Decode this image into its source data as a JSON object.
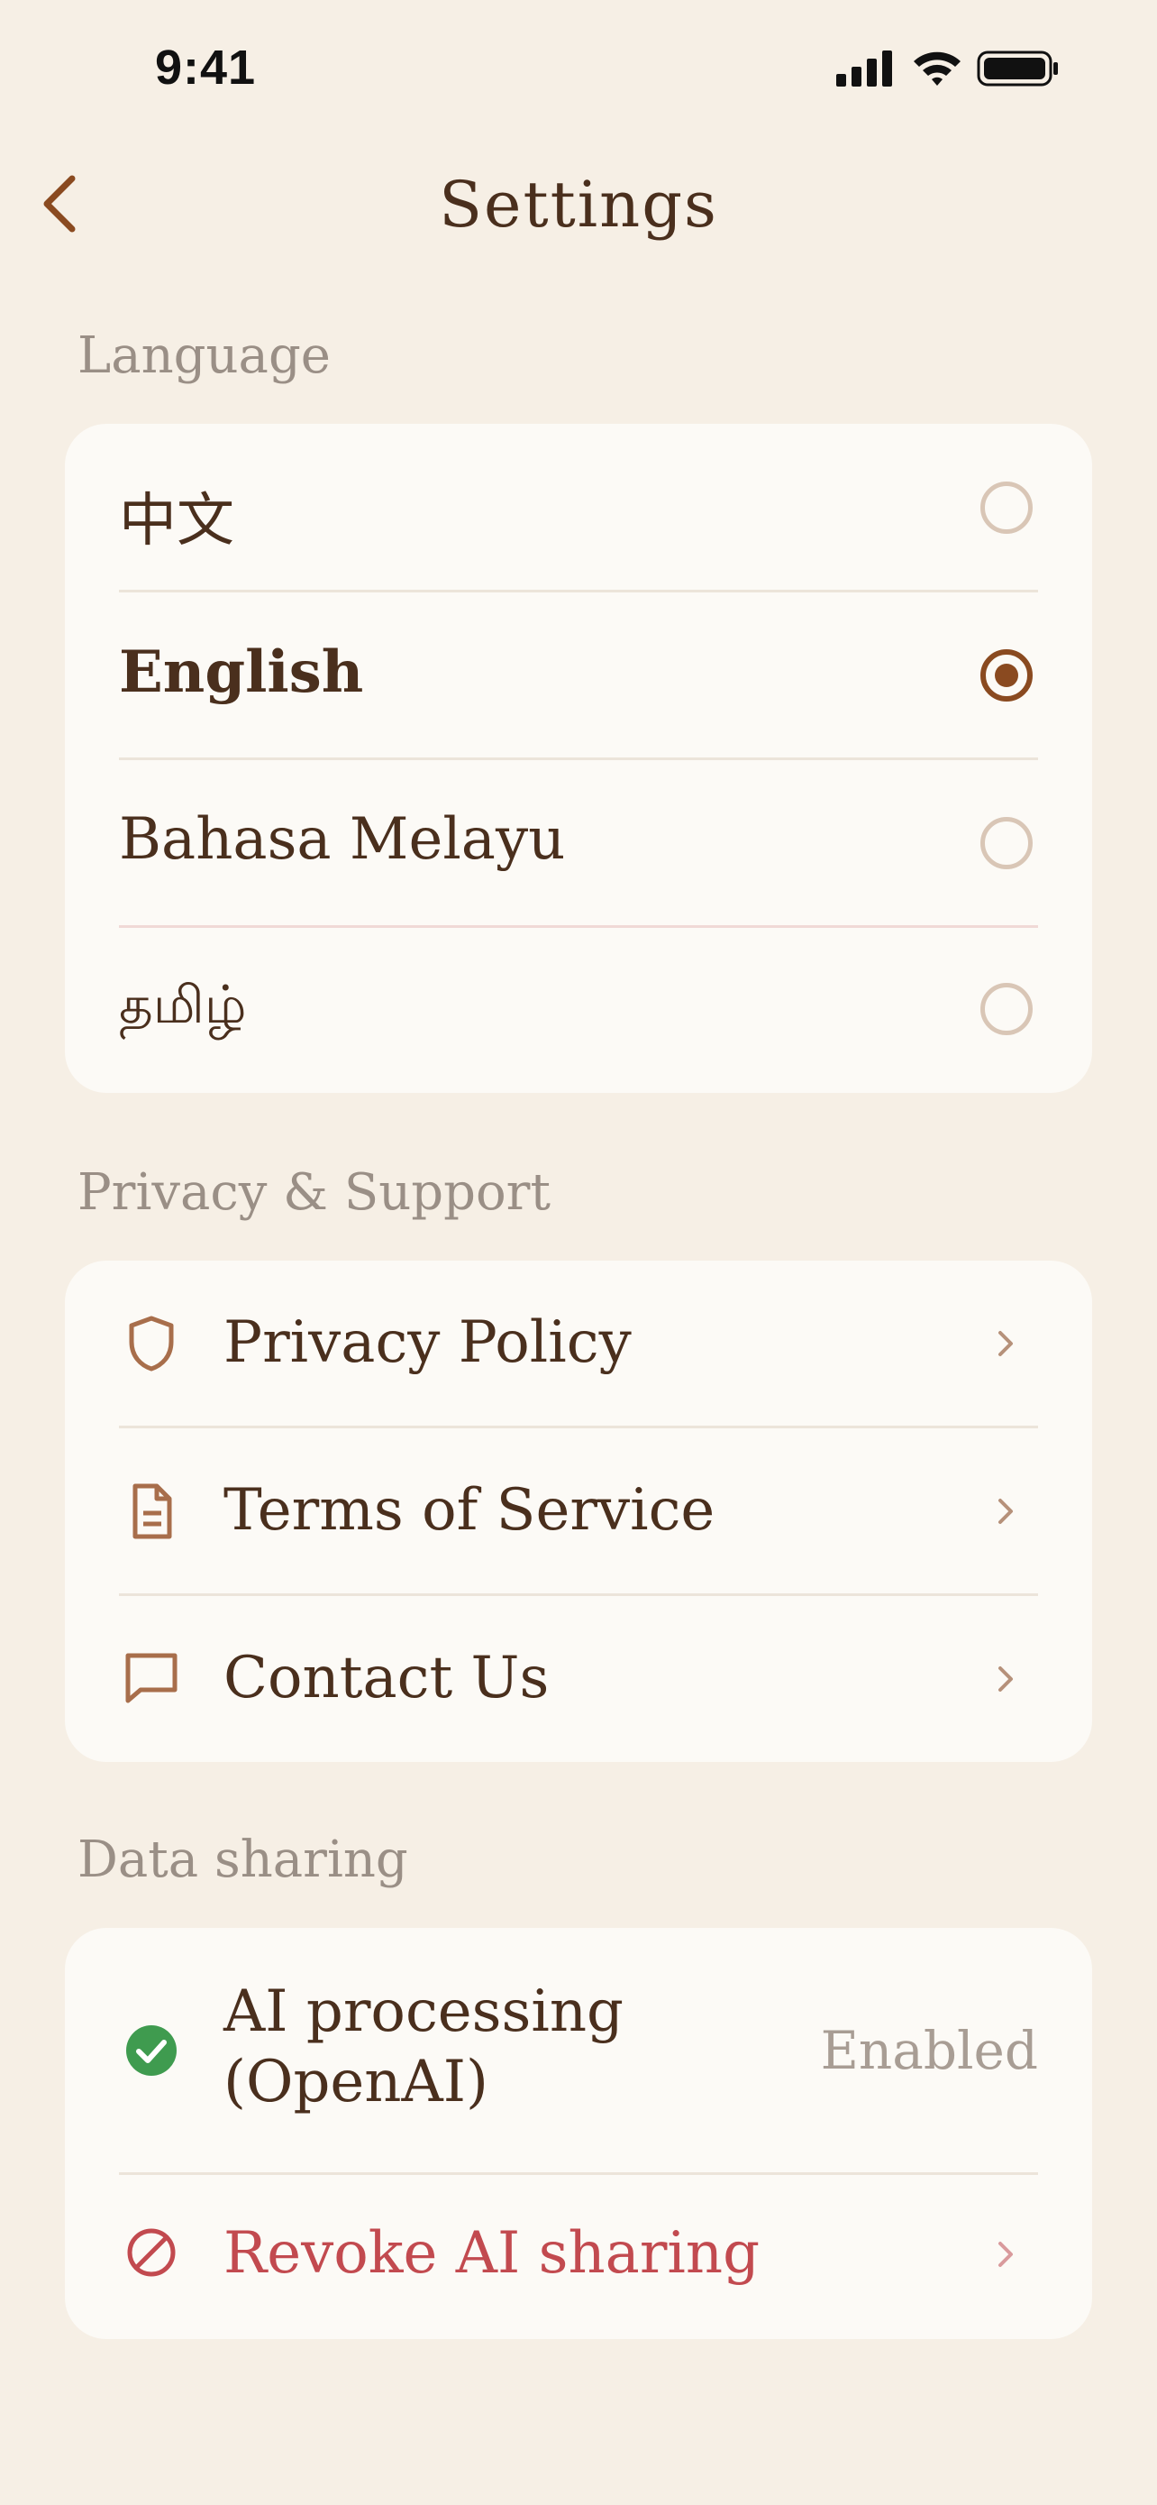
{
  "status_bar": {
    "time": "9:41"
  },
  "nav": {
    "title": "Settings"
  },
  "language": {
    "header": "Language",
    "options": [
      {
        "label": "中文",
        "selected": false
      },
      {
        "label": "English",
        "selected": true
      },
      {
        "label": "Bahasa Melayu",
        "selected": false
      },
      {
        "label": "தமிழ்",
        "selected": false
      }
    ]
  },
  "privacy": {
    "header": "Privacy & Support",
    "items": [
      {
        "label": "Privacy Policy",
        "icon": "shield-icon"
      },
      {
        "label": "Terms of Service",
        "icon": "document-icon"
      },
      {
        "label": "Contact Us",
        "icon": "chat-bubble-icon"
      }
    ]
  },
  "data_sharing": {
    "header": "Data sharing",
    "ai_processing": {
      "label_line1": "AI processing",
      "label_line2": "(OpenAI)",
      "value": "Enabled",
      "icon": "check-circle-icon"
    },
    "revoke": {
      "label": "Revoke AI sharing",
      "icon": "prohibited-icon"
    }
  },
  "colors": {
    "background": "#f6efe5",
    "card": "#fcfaf6",
    "accent": "#8a4a20",
    "text": "#4a2f1d",
    "muted": "#9a8f86",
    "success": "#3f9b4f",
    "danger": "#c24a4f"
  }
}
